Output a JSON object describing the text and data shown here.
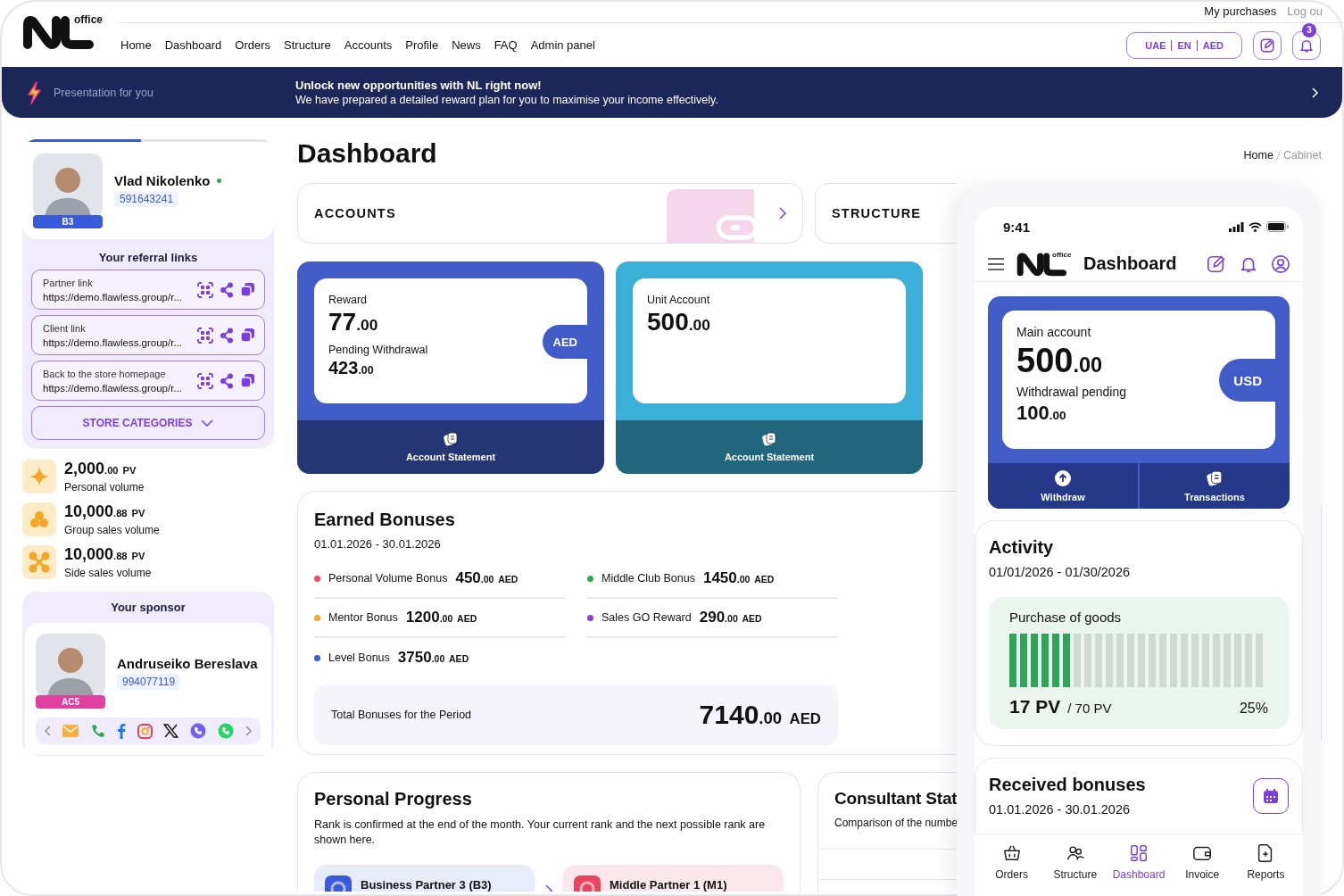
{
  "header": {
    "logo_suffix": "office",
    "nav": [
      "Home",
      "Dashboard",
      "Orders",
      "Structure",
      "Accounts",
      "Profile",
      "News",
      "FAQ",
      "Admin panel"
    ],
    "top_links": [
      "My purchases",
      "Log ou"
    ],
    "locale": [
      "UAE",
      "EN",
      "AED"
    ],
    "notification_count": "3"
  },
  "banner": {
    "link": "Presentation for you",
    "title": "Unlock new opportunities with NL right now!",
    "text": "We have prepared a detailed reward plan for you to maximise your income effectively."
  },
  "profile": {
    "name": "Vlad Nikolenko",
    "online": true,
    "id": "591643241",
    "rank": "B3",
    "level": 0.47
  },
  "referral": {
    "title": "Your referral links",
    "links": [
      {
        "label": "Partner link",
        "url": "https://demo.flawless.group/r..."
      },
      {
        "label": "Client link",
        "url": "https://demo.flawless.group/r..."
      },
      {
        "label": "Back to the store homepage",
        "url": "https://demo.flawless.group/r..."
      }
    ],
    "categories_button": "STORE CATEGORIES"
  },
  "volumes": [
    {
      "value": "2,000.00",
      "unit": "PV",
      "label": "Personal volume"
    },
    {
      "value": "10,000.88",
      "unit": "PV",
      "label": "Group sales volume"
    },
    {
      "value": "10,000.88",
      "unit": "PV",
      "label": "Side sales volume"
    }
  ],
  "sponsor": {
    "title": "Your sponsor",
    "name": "Andruseiko Bereslava",
    "id": "994077119",
    "rank": "AC5"
  },
  "page": {
    "title": "Dashboard",
    "breadcrumb": [
      "Home",
      "Cabinet"
    ]
  },
  "sections": [
    {
      "label": "ACCOUNTS"
    },
    {
      "label": "STRUCTURE"
    }
  ],
  "accounts": [
    {
      "color": "#425cc7",
      "label": "Reward",
      "value": "77.00",
      "pending_label": "Pending Withdrawal",
      "pending_value": "423.00",
      "currency": "AED",
      "action": "Account Statement"
    },
    {
      "color": "#3ab0d8",
      "label": "Unit Account",
      "value": "500.00",
      "action": "Account Statement"
    }
  ],
  "earned_bonuses": {
    "title": "Earned Bonuses",
    "period": "01.01.2026 - 30.01.2026",
    "items": [
      {
        "name": "Personal Volume Bonus",
        "value": "450.00",
        "currency": "AED",
        "color": "#ee4a6b"
      },
      {
        "name": "Middle Club Bonus",
        "value": "1450.00",
        "currency": "AED",
        "color": "#2ea55a"
      },
      {
        "name": "Mentor Bonus",
        "value": "1200.00",
        "currency": "AED",
        "color": "#f5a623"
      },
      {
        "name": "Sales GO Reward",
        "value": "290.00",
        "currency": "AED",
        "color": "#8a3fe0"
      },
      {
        "name": "Level Bonus",
        "value": "3750.00",
        "currency": "AED",
        "color": "#3a5bd9"
      }
    ],
    "total_label": "Total Bonuses for the Period",
    "total_value": "7140.00",
    "total_currency": "AED"
  },
  "progress": {
    "title": "Personal Progress",
    "text": "Rank is confirmed at the end of the month. Your current rank and the next possible rank are shown here.",
    "ranks": [
      {
        "name": "Business Partner 3 (B3)",
        "color": "#3a5bd9"
      },
      {
        "name": "Middle Partner 1 (M1)",
        "color": "#e8435f"
      }
    ]
  },
  "consultant": {
    "title": "Consultant Stat",
    "text": "Comparison of the numbe"
  },
  "phone": {
    "time": "9:41",
    "logo_suffix": "office",
    "title": "Dashboard",
    "account": {
      "label": "Main account",
      "value": "500.00",
      "pending_label": "Withdrawal pending",
      "pending_value": "100.00",
      "currency": "USD",
      "actions": [
        "Withdraw",
        "Transactions"
      ]
    },
    "activity": {
      "title": "Activity",
      "period": "01/01/2026 - 01/30/2026",
      "meter_label": "Purchase of goods",
      "level": 0.25,
      "value": "17 PV",
      "target": "/ 70 PV",
      "percent": "25%"
    },
    "received": {
      "title": "Received bonuses",
      "period": "01.01.2026 - 30.01.2026"
    },
    "tabs": [
      {
        "label": "Orders",
        "selected": false
      },
      {
        "label": "Structure",
        "selected": false
      },
      {
        "label": "Dashboard",
        "selected": true
      },
      {
        "label": "Invoice",
        "selected": false
      },
      {
        "label": "Reports",
        "selected": false
      }
    ]
  }
}
